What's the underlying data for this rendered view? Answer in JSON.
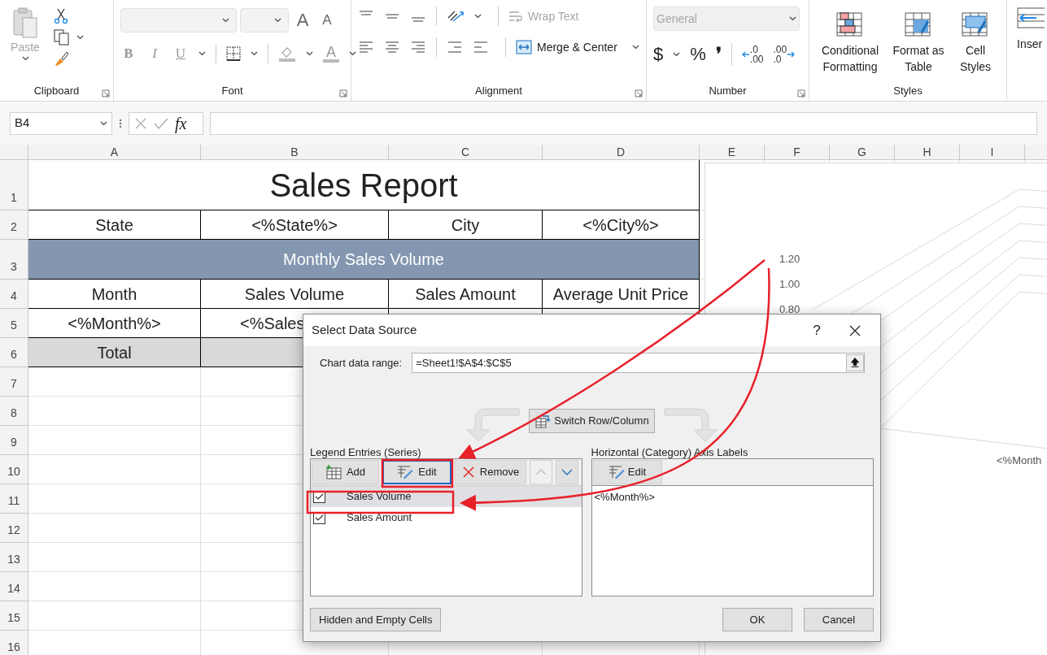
{
  "ribbon": {
    "clipboard": {
      "paste": {
        "label": "Paste",
        "disabled": true
      },
      "group_label": "Clipboard"
    },
    "font": {
      "group_label": "Font",
      "style_buttons": [
        {
          "glyph": "B",
          "kind": "bold"
        },
        {
          "glyph": "I",
          "kind": "italic"
        },
        {
          "glyph": "U",
          "kind": "underline"
        }
      ],
      "size_buttons": [
        {
          "glyph": "A",
          "kind": "grow"
        },
        {
          "glyph": "A",
          "kind": "shrink"
        }
      ],
      "color_glyph": "A"
    },
    "alignment": {
      "group_label": "Alignment",
      "wrap_text": {
        "label": "Wrap Text",
        "disabled": true
      },
      "merge_center": {
        "label": "Merge & Center",
        "disabled": false
      }
    },
    "number": {
      "group_label": "Number",
      "format": {
        "value": "General",
        "disabled": true
      },
      "symbols": [
        "$",
        "%",
        "❜"
      ],
      "decimals": [
        {
          "kind": "increase",
          "top": ".0",
          "bottom": ".00"
        },
        {
          "kind": "decrease",
          "top": ".00",
          "bottom": ".0"
        }
      ]
    },
    "styles": {
      "group_label": "Styles",
      "buttons": [
        {
          "kind": "conditional",
          "label": "Conditional Formatting"
        },
        {
          "kind": "table",
          "label": "Format as Table"
        },
        {
          "kind": "cell",
          "label": "Cell Styles"
        }
      ]
    },
    "insert": {
      "label": "Inser"
    }
  },
  "formula_bar": {
    "name_box": "B4",
    "fx_label": "fx"
  },
  "sheet": {
    "columns": [
      "A",
      "B",
      "C",
      "D",
      "E",
      "F",
      "G",
      "H",
      "I"
    ],
    "rows": [
      {
        "number": "1",
        "cells": [
          {
            "text": "Sales Report",
            "kind": "title"
          }
        ]
      },
      {
        "number": "2",
        "cells": [
          {
            "text": "State"
          },
          {
            "text": "<%State%>"
          },
          {
            "text": "City"
          },
          {
            "text": "<%City%>"
          }
        ]
      },
      {
        "number": "3",
        "cells": [
          {
            "text": "Monthly Sales Volume",
            "kind": "banner"
          }
        ]
      },
      {
        "number": "4",
        "cells": [
          {
            "text": "Month"
          },
          {
            "text": "Sales Volume"
          },
          {
            "text": "Sales Amount"
          },
          {
            "text": "Average Unit Price"
          }
        ]
      },
      {
        "number": "5",
        "cells": [
          {
            "text": "<%Month%>"
          },
          {
            "text": "<%Sales",
            "kind": "cut"
          },
          {
            "kind": "plain"
          },
          {
            "kind": "plain"
          }
        ]
      },
      {
        "number": "6",
        "cells": [
          {
            "text": "Total",
            "kind": "total"
          },
          {
            "kind": "total"
          }
        ]
      },
      {
        "number": "7"
      },
      {
        "number": "8"
      },
      {
        "number": "9"
      },
      {
        "number": "10"
      },
      {
        "number": "11"
      },
      {
        "number": "12"
      },
      {
        "number": "13"
      },
      {
        "number": "14"
      },
      {
        "number": "15"
      },
      {
        "number": "16"
      }
    ]
  },
  "chart": {
    "y_axis_labels": [
      "1.20",
      "1.00",
      "0.80"
    ],
    "category_label": "<%Month"
  },
  "dialog": {
    "title": "Select Data Source",
    "help": "?",
    "range_label": "Chart data range:",
    "range_value": "=Sheet1!$A$4:$C$5",
    "switch_button": "Switch Row/Column",
    "legend": {
      "label": "Legend Entries (Series)",
      "buttons": [
        {
          "kind": "add",
          "label": "Add"
        },
        {
          "kind": "edit",
          "label": "Edit"
        },
        {
          "kind": "remove",
          "label": "Remove"
        }
      ],
      "move_buttons": [
        {
          "kind": "up",
          "disabled": true
        },
        {
          "kind": "down",
          "disabled": false
        }
      ],
      "series": [
        {
          "name": "Sales Volume",
          "checked": true,
          "selected": true
        },
        {
          "name": "Sales Amount",
          "checked": true,
          "selected": false
        }
      ]
    },
    "axis": {
      "label": "Horizontal (Category) Axis Labels",
      "edit_button": "Edit",
      "items": [
        "<%Month%>"
      ]
    },
    "footer_buttons": [
      {
        "kind": "left",
        "label": "Hidden and Empty Cells"
      },
      {
        "kind": "right",
        "label": "OK"
      },
      {
        "kind": "right",
        "label": "Cancel"
      }
    ]
  }
}
